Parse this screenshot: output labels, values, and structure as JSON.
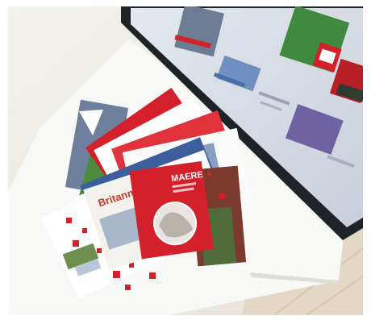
{
  "photo": {
    "brochure_front_title": "MAERE",
    "brochure_side_text": "Britannia"
  },
  "colors": {
    "floor": "#efece6",
    "floor_wood": "#e6ddd0",
    "table_top": "#f7f7f5",
    "monitor_frame": "#1f2226",
    "monitor_screen": "#d5dae3",
    "brand_red": "#d4202a",
    "tile_blue": "#4b6fa8",
    "tile_green": "#3f8a3f",
    "tile_purple": "#6e62a3"
  }
}
